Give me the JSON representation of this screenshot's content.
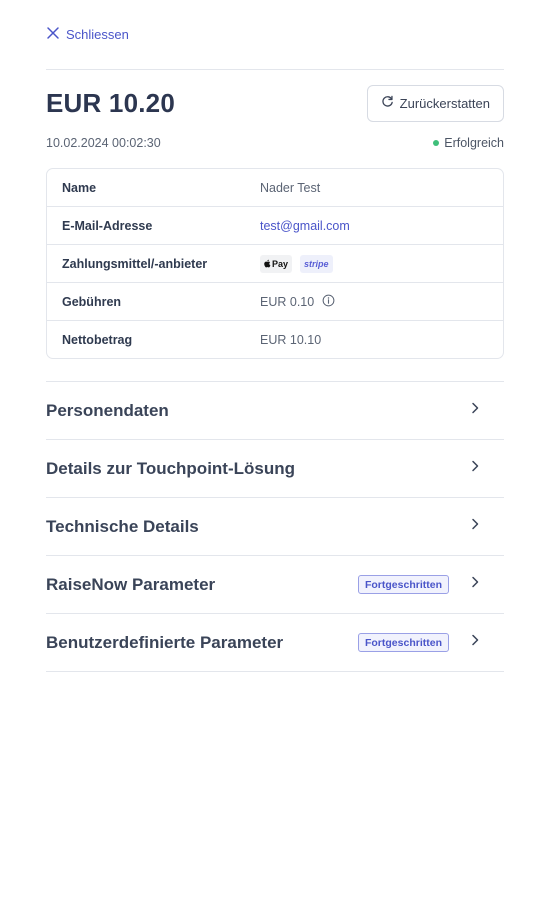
{
  "close": {
    "label": "Schliessen"
  },
  "transaction": {
    "amount": "EUR 10.20",
    "refund_label": "Zurückerstatten",
    "datetime": "10.02.2024 00:02:30",
    "status": "Erfolgreich",
    "status_color": "#3fbf7a"
  },
  "details": {
    "rows": [
      {
        "label": "Name",
        "value": "Nader Test"
      },
      {
        "label": "E-Mail-Adresse",
        "value": "test@gmail.com"
      },
      {
        "label": "Zahlungsmittel/-anbieter",
        "apple_pay": "Pay",
        "stripe": "stripe"
      },
      {
        "label": "Gebühren",
        "value": "EUR 0.10"
      },
      {
        "label": "Nettobetrag",
        "value": "EUR 10.10"
      }
    ]
  },
  "sections": [
    {
      "title": "Personendaten"
    },
    {
      "title": "Details zur Touchpoint-Lösung"
    },
    {
      "title": "Technische Details"
    },
    {
      "title": "RaiseNow Parameter",
      "badge": "Fortgeschritten"
    },
    {
      "title": "Benutzerdefinierte Parameter",
      "badge": "Fortgeschritten"
    }
  ],
  "colors": {
    "accent": "#4a55c9",
    "success": "#3fbf7a"
  }
}
